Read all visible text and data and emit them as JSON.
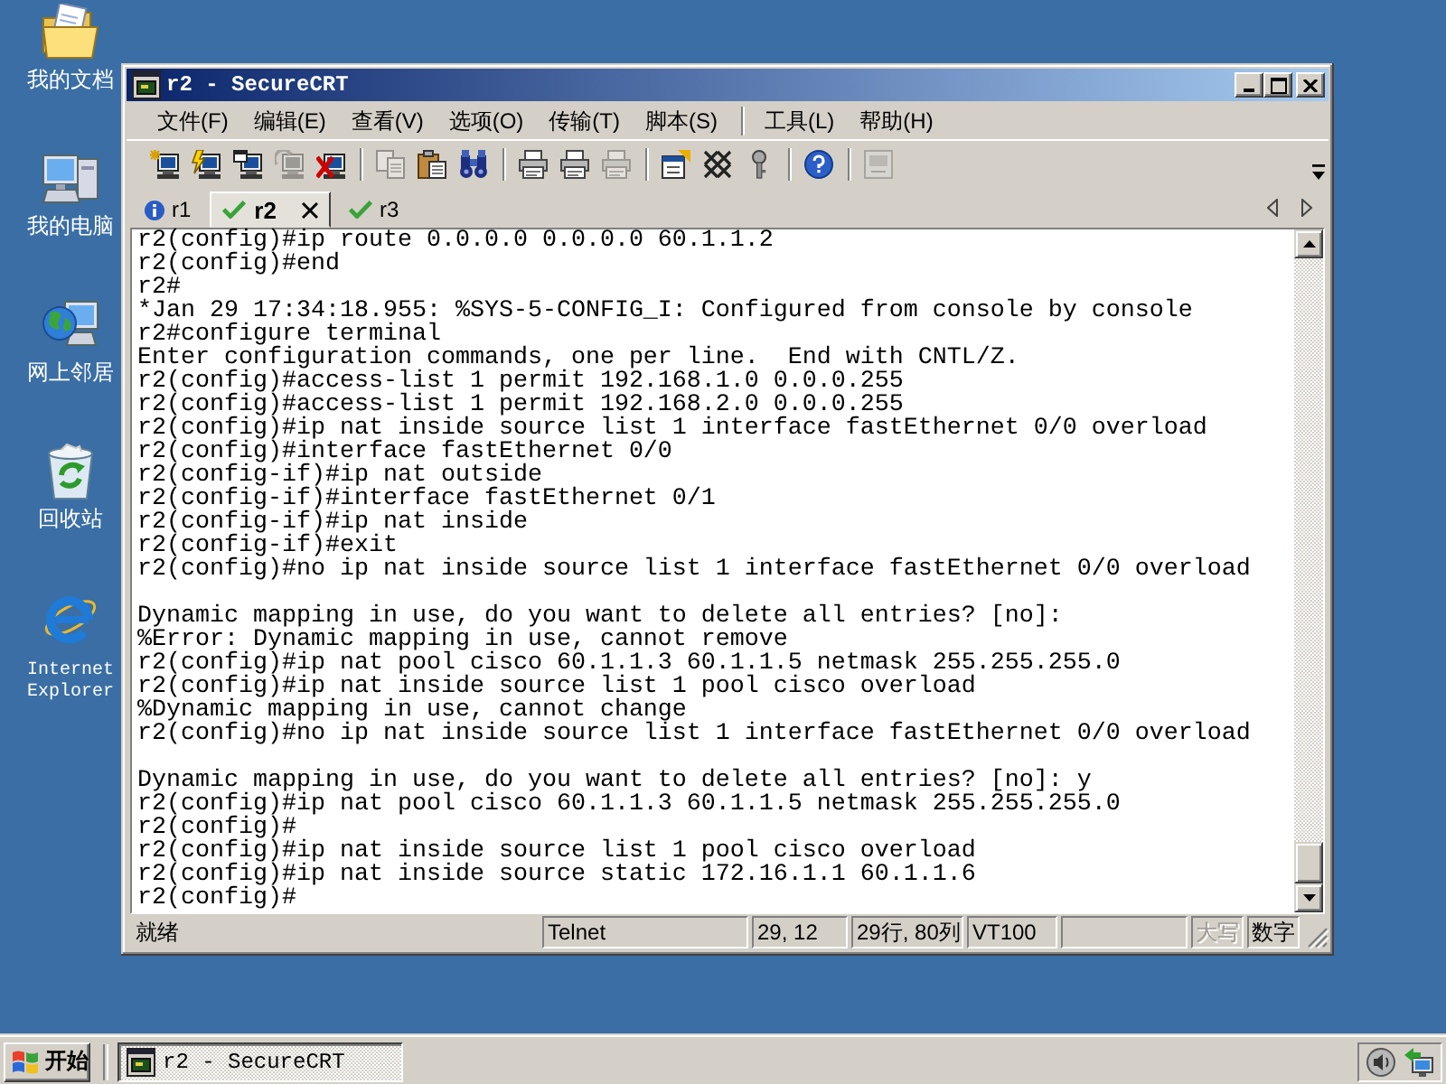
{
  "desktop_icons": [
    {
      "label": "我的文档",
      "kind": "documents"
    },
    {
      "label": "我的电脑",
      "kind": "computer"
    },
    {
      "label": "网上邻居",
      "kind": "network"
    },
    {
      "label": "回收站",
      "kind": "trash"
    },
    {
      "label": "Internet Explorer",
      "kind": "browser"
    }
  ],
  "window": {
    "title": "r2 - SecureCRT",
    "menu_groups": [
      {
        "items": [
          "文件(F)",
          "编辑(E)",
          "查看(V)",
          "选项(O)",
          "传输(T)",
          "脚本(S)"
        ]
      },
      {
        "items": [
          "工具(L)",
          "帮助(H)"
        ]
      }
    ],
    "toolbar_groups": [
      {
        "buttons": [
          {
            "disabled": false
          },
          {
            "disabled": false
          },
          {
            "disabled": false
          },
          {
            "disabled": true
          },
          {
            "disabled": false
          }
        ]
      },
      {
        "buttons": [
          {
            "disabled": true
          },
          {
            "disabled": false
          },
          {
            "disabled": false
          }
        ]
      },
      {
        "buttons": [
          {
            "disabled": false
          },
          {
            "disabled": false
          },
          {
            "disabled": true
          }
        ]
      },
      {
        "buttons": [
          {
            "disabled": false
          },
          {
            "disabled": false
          },
          {
            "disabled": false
          }
        ]
      },
      {
        "buttons": [
          {
            "disabled": false
          }
        ]
      },
      {
        "buttons": [
          {
            "disabled": true
          }
        ]
      }
    ],
    "tabs": [
      {
        "label": "r1",
        "selected": false,
        "notice": true
      },
      {
        "label": "r2",
        "selected": true,
        "notice": false
      },
      {
        "label": "r3",
        "selected": false,
        "notice": false
      }
    ],
    "terminal": {
      "blocks": [
        {
          "lines": [
            "r2(config)#ip route 0.0.0.0 0.0.0.0 60.1.1.2",
            "r2(config)#end",
            "r2#",
            "*Jan 29 17:34:18.955: %SYS-5-CONFIG_I: Configured from console by console",
            "r2#configure terminal",
            "Enter configuration commands, one per line.  End with CNTL/Z.",
            "r2(config)#access-list 1 permit 192.168.1.0 0.0.0.255",
            "r2(config)#access-list 1 permit 192.168.2.0 0.0.0.255",
            "r2(config)#ip nat inside source list 1 interface fastEthernet 0/0 overload",
            "r2(config)#interface fastEthernet 0/0",
            "r2(config-if)#ip nat outside",
            "r2(config-if)#interface fastEthernet 0/1",
            "r2(config-if)#ip nat inside",
            "r2(config-if)#exit",
            "r2(config)#no ip nat inside source list 1 interface fastEthernet 0/0 overload"
          ]
        },
        {
          "lines": [
            "Dynamic mapping in use, do you want to delete all entries? [no]:",
            "%Error: Dynamic mapping in use, cannot remove",
            "r2(config)#ip nat pool cisco 60.1.1.3 60.1.1.5 netmask 255.255.255.0",
            "r2(config)#ip nat inside source list 1 pool cisco overload",
            "%Dynamic mapping in use, cannot change",
            "r2(config)#no ip nat inside source list 1 interface fastEthernet 0/0 overload"
          ]
        },
        {
          "lines": [
            "Dynamic mapping in use, do you want to delete all entries? [no]: y",
            "r2(config)#ip nat pool cisco 60.1.1.3 60.1.1.5 netmask 255.255.255.0",
            "r2(config)#",
            "r2(config)#ip nat inside source list 1 pool cisco overload",
            "r2(config)#ip nat inside source static 172.16.1.1 60.1.1.6",
            "r2(config)#"
          ]
        }
      ]
    },
    "status_bar": {
      "message": "就绪",
      "protocol": "Telnet",
      "cursor": "29, 12",
      "size": "29行, 80列",
      "emulation": "VT100",
      "indicators": [
        {
          "label": "大写",
          "on": false
        },
        {
          "label": "数字",
          "on": true
        }
      ]
    }
  },
  "taskbar": {
    "start": "开始",
    "tasks": [
      {
        "label": "r2 - SecureCRT",
        "selected": true
      }
    ]
  }
}
